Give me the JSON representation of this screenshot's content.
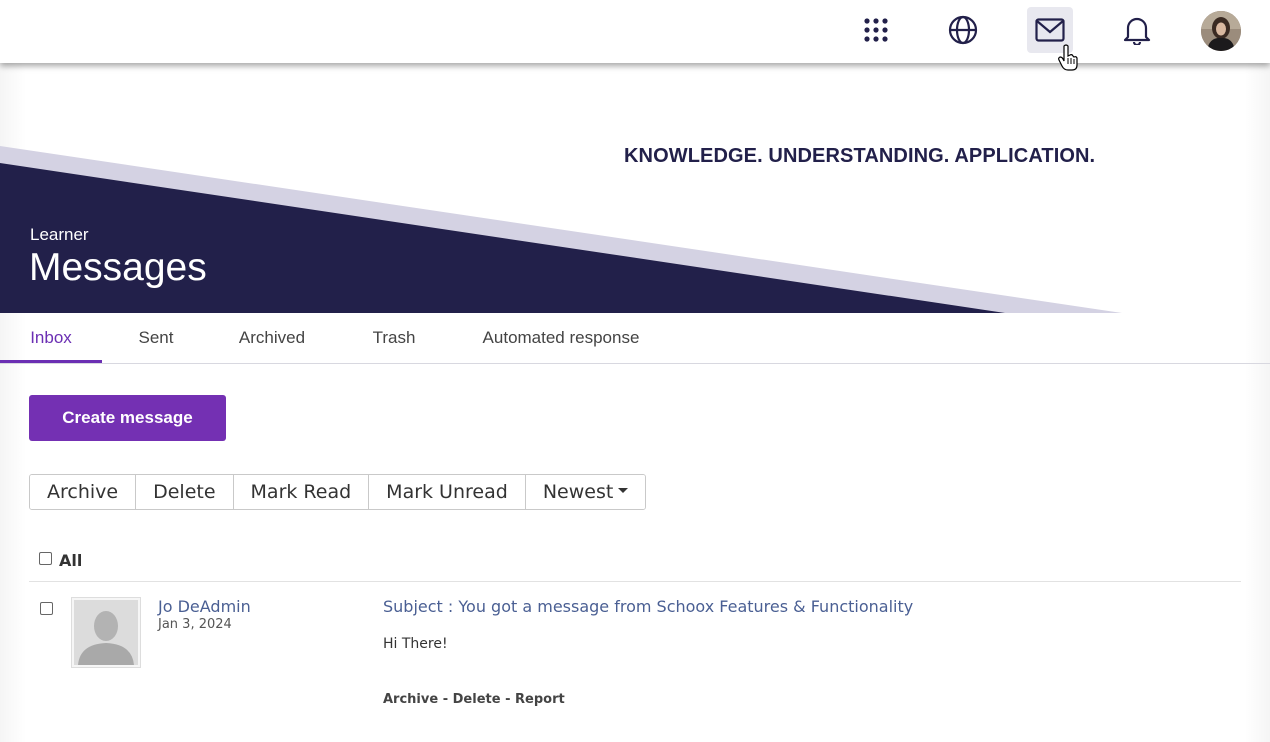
{
  "header": {
    "icons": [
      {
        "name": "apps-grid-icon"
      },
      {
        "name": "globe-icon"
      },
      {
        "name": "mail-icon",
        "active": true
      },
      {
        "name": "bell-icon"
      },
      {
        "name": "user-avatar"
      }
    ]
  },
  "banner": {
    "tagline": "KNOWLEDGE. UNDERSTANDING. APPLICATION.",
    "role": "Learner",
    "title": "Messages",
    "colors": {
      "dark": "#22204a",
      "light": "#d4d2e3"
    }
  },
  "tabs": [
    {
      "label": "Inbox",
      "active": true
    },
    {
      "label": "Sent"
    },
    {
      "label": "Archived"
    },
    {
      "label": "Trash"
    },
    {
      "label": "Automated response"
    }
  ],
  "create_button": "Create message",
  "actions": {
    "archive": "Archive",
    "delete": "Delete",
    "mark_read": "Mark Read",
    "mark_unread": "Mark Unread",
    "sort": "Newest"
  },
  "select_all_label": "All",
  "messages": [
    {
      "sender": "Jo DeAdmin",
      "date": "Jan 3, 2024",
      "subject": "Subject : You got a message from Schoox Features & Functionality",
      "preview": "Hi There!",
      "row_actions": {
        "archive": "Archive",
        "separator": " - ",
        "delete": "Delete",
        "report": "Report"
      }
    }
  ],
  "colors": {
    "accent": "#7430b3",
    "link": "#4a5f93",
    "navy": "#22204a"
  }
}
